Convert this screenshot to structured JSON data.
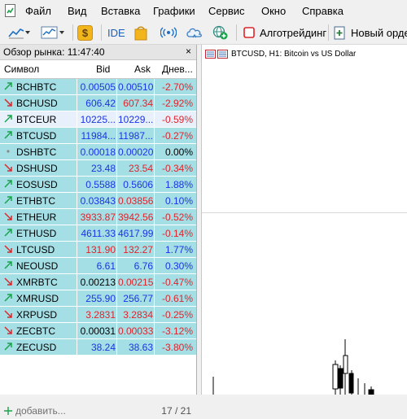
{
  "menu": [
    "Файл",
    "Вид",
    "Вставка",
    "Графики",
    "Сервис",
    "Окно",
    "Справка"
  ],
  "toolbar": {
    "ide_label": "IDE",
    "algo_label": "Алготрейдинг",
    "new_order_label": "Новый орде"
  },
  "market_watch": {
    "title": "Обзор рынка: 11:47:40",
    "close": "×",
    "columns": {
      "symbol": "Символ",
      "bid": "Bid",
      "ask": "Ask",
      "change": "Днев..."
    },
    "rows": [
      {
        "symbol": "BCHBTC",
        "bid": "0.00505",
        "ask": "0.00510",
        "change": "-2.70%",
        "dir": "up",
        "bidc": "blue",
        "askc": "blue",
        "chgc": "red"
      },
      {
        "symbol": "BCHUSD",
        "bid": "606.42",
        "ask": "607.34",
        "change": "-2.92%",
        "dir": "down",
        "bidc": "blue",
        "askc": "red",
        "chgc": "red"
      },
      {
        "symbol": "BTCEUR",
        "bid": "10225...",
        "ask": "10229...",
        "change": "-0.59%",
        "dir": "up",
        "bidc": "blue",
        "askc": "blue",
        "chgc": "red"
      },
      {
        "symbol": "BTCUSD",
        "bid": "11984...",
        "ask": "11987...",
        "change": "-0.27%",
        "dir": "up",
        "bidc": "blue",
        "askc": "blue",
        "chgc": "red"
      },
      {
        "symbol": "DSHBTC",
        "bid": "0.00018",
        "ask": "0.00020",
        "change": "0.00%",
        "dir": "none",
        "bidc": "blue",
        "askc": "blue",
        "chgc": "dark"
      },
      {
        "symbol": "DSHUSD",
        "bid": "23.48",
        "ask": "23.54",
        "change": "-0.34%",
        "dir": "down",
        "bidc": "blue",
        "askc": "red",
        "chgc": "red"
      },
      {
        "symbol": "EOSUSD",
        "bid": "0.5588",
        "ask": "0.5606",
        "change": "1.88%",
        "dir": "up",
        "bidc": "blue",
        "askc": "blue",
        "chgc": "blue"
      },
      {
        "symbol": "ETHBTC",
        "bid": "0.03843",
        "ask": "0.03856",
        "change": "0.10%",
        "dir": "up",
        "bidc": "blue",
        "askc": "red",
        "chgc": "blue"
      },
      {
        "symbol": "ETHEUR",
        "bid": "3933.87",
        "ask": "3942.56",
        "change": "-0.52%",
        "dir": "down",
        "bidc": "red",
        "askc": "red",
        "chgc": "red"
      },
      {
        "symbol": "ETHUSD",
        "bid": "4611.33",
        "ask": "4617.99",
        "change": "-0.14%",
        "dir": "up",
        "bidc": "blue",
        "askc": "blue",
        "chgc": "red"
      },
      {
        "symbol": "LTCUSD",
        "bid": "131.90",
        "ask": "132.27",
        "change": "1.77%",
        "dir": "down",
        "bidc": "red",
        "askc": "red",
        "chgc": "blue"
      },
      {
        "symbol": "NEOUSD",
        "bid": "6.61",
        "ask": "6.76",
        "change": "0.30%",
        "dir": "up",
        "bidc": "blue",
        "askc": "blue",
        "chgc": "blue"
      },
      {
        "symbol": "XMRBTC",
        "bid": "0.00213",
        "ask": "0.00215",
        "change": "-0.47%",
        "dir": "down",
        "bidc": "dark",
        "askc": "red",
        "chgc": "red"
      },
      {
        "symbol": "XMRUSD",
        "bid": "255.90",
        "ask": "256.77",
        "change": "-0.61%",
        "dir": "up",
        "bidc": "blue",
        "askc": "blue",
        "chgc": "red"
      },
      {
        "symbol": "XRPUSD",
        "bid": "3.2831",
        "ask": "3.2834",
        "change": "-0.25%",
        "dir": "down",
        "bidc": "red",
        "askc": "red",
        "chgc": "red"
      },
      {
        "symbol": "ZECBTC",
        "bid": "0.00031",
        "ask": "0.00033",
        "change": "-3.12%",
        "dir": "down",
        "bidc": "dark",
        "askc": "red",
        "chgc": "red"
      },
      {
        "symbol": "ZECUSD",
        "bid": "38.24",
        "ask": "38.63",
        "change": "-3.80%",
        "dir": "up",
        "bidc": "blue",
        "askc": "blue",
        "chgc": "red"
      }
    ],
    "add_label": "добавить...",
    "count": "17 / 21"
  },
  "chart": {
    "title": "BTCUSD, H1:  Bitcoin vs US Dollar"
  },
  "colors": {
    "row_bg": "#a5dfe6",
    "selected_row_bg": "#e8f1fb",
    "up_arrow": "#19a34a",
    "down_arrow": "#d8282e",
    "bid_blue": "#1a33e6",
    "red": "#e0222a"
  },
  "icons": {
    "menu_app": "app-document-icon",
    "line_chart": "line-chart-icon",
    "chart_templates": "chart-templates-icon",
    "dollar": "dollar-coin-icon",
    "market_bag": "shopping-bag-icon",
    "signal": "signal-broadcast-icon",
    "cloud": "cloud-icon",
    "vps": "globe-plus-icon",
    "algo": "algo-trading-icon",
    "new_order": "new-order-icon"
  },
  "selected_row_index": 2
}
